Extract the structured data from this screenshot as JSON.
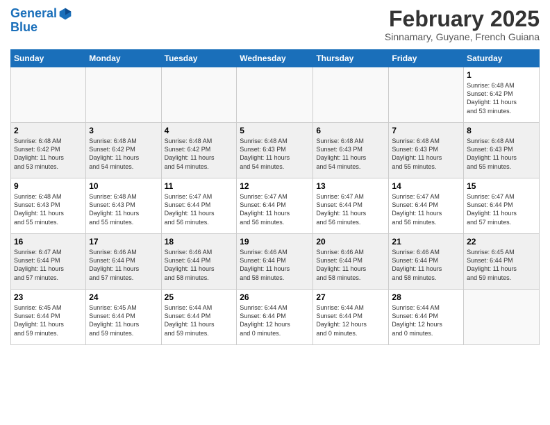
{
  "logo": {
    "line1": "General",
    "line2": "Blue"
  },
  "title": "February 2025",
  "subtitle": "Sinnamary, Guyane, French Guiana",
  "days_of_week": [
    "Sunday",
    "Monday",
    "Tuesday",
    "Wednesday",
    "Thursday",
    "Friday",
    "Saturday"
  ],
  "weeks": [
    {
      "shaded": false,
      "days": [
        {
          "num": "",
          "info": ""
        },
        {
          "num": "",
          "info": ""
        },
        {
          "num": "",
          "info": ""
        },
        {
          "num": "",
          "info": ""
        },
        {
          "num": "",
          "info": ""
        },
        {
          "num": "",
          "info": ""
        },
        {
          "num": "1",
          "info": "Sunrise: 6:48 AM\nSunset: 6:42 PM\nDaylight: 11 hours\nand 53 minutes."
        }
      ]
    },
    {
      "shaded": true,
      "days": [
        {
          "num": "2",
          "info": "Sunrise: 6:48 AM\nSunset: 6:42 PM\nDaylight: 11 hours\nand 53 minutes."
        },
        {
          "num": "3",
          "info": "Sunrise: 6:48 AM\nSunset: 6:42 PM\nDaylight: 11 hours\nand 54 minutes."
        },
        {
          "num": "4",
          "info": "Sunrise: 6:48 AM\nSunset: 6:42 PM\nDaylight: 11 hours\nand 54 minutes."
        },
        {
          "num": "5",
          "info": "Sunrise: 6:48 AM\nSunset: 6:43 PM\nDaylight: 11 hours\nand 54 minutes."
        },
        {
          "num": "6",
          "info": "Sunrise: 6:48 AM\nSunset: 6:43 PM\nDaylight: 11 hours\nand 54 minutes."
        },
        {
          "num": "7",
          "info": "Sunrise: 6:48 AM\nSunset: 6:43 PM\nDaylight: 11 hours\nand 55 minutes."
        },
        {
          "num": "8",
          "info": "Sunrise: 6:48 AM\nSunset: 6:43 PM\nDaylight: 11 hours\nand 55 minutes."
        }
      ]
    },
    {
      "shaded": false,
      "days": [
        {
          "num": "9",
          "info": "Sunrise: 6:48 AM\nSunset: 6:43 PM\nDaylight: 11 hours\nand 55 minutes."
        },
        {
          "num": "10",
          "info": "Sunrise: 6:48 AM\nSunset: 6:43 PM\nDaylight: 11 hours\nand 55 minutes."
        },
        {
          "num": "11",
          "info": "Sunrise: 6:47 AM\nSunset: 6:44 PM\nDaylight: 11 hours\nand 56 minutes."
        },
        {
          "num": "12",
          "info": "Sunrise: 6:47 AM\nSunset: 6:44 PM\nDaylight: 11 hours\nand 56 minutes."
        },
        {
          "num": "13",
          "info": "Sunrise: 6:47 AM\nSunset: 6:44 PM\nDaylight: 11 hours\nand 56 minutes."
        },
        {
          "num": "14",
          "info": "Sunrise: 6:47 AM\nSunset: 6:44 PM\nDaylight: 11 hours\nand 56 minutes."
        },
        {
          "num": "15",
          "info": "Sunrise: 6:47 AM\nSunset: 6:44 PM\nDaylight: 11 hours\nand 57 minutes."
        }
      ]
    },
    {
      "shaded": true,
      "days": [
        {
          "num": "16",
          "info": "Sunrise: 6:47 AM\nSunset: 6:44 PM\nDaylight: 11 hours\nand 57 minutes."
        },
        {
          "num": "17",
          "info": "Sunrise: 6:46 AM\nSunset: 6:44 PM\nDaylight: 11 hours\nand 57 minutes."
        },
        {
          "num": "18",
          "info": "Sunrise: 6:46 AM\nSunset: 6:44 PM\nDaylight: 11 hours\nand 58 minutes."
        },
        {
          "num": "19",
          "info": "Sunrise: 6:46 AM\nSunset: 6:44 PM\nDaylight: 11 hours\nand 58 minutes."
        },
        {
          "num": "20",
          "info": "Sunrise: 6:46 AM\nSunset: 6:44 PM\nDaylight: 11 hours\nand 58 minutes."
        },
        {
          "num": "21",
          "info": "Sunrise: 6:46 AM\nSunset: 6:44 PM\nDaylight: 11 hours\nand 58 minutes."
        },
        {
          "num": "22",
          "info": "Sunrise: 6:45 AM\nSunset: 6:44 PM\nDaylight: 11 hours\nand 59 minutes."
        }
      ]
    },
    {
      "shaded": false,
      "days": [
        {
          "num": "23",
          "info": "Sunrise: 6:45 AM\nSunset: 6:44 PM\nDaylight: 11 hours\nand 59 minutes."
        },
        {
          "num": "24",
          "info": "Sunrise: 6:45 AM\nSunset: 6:44 PM\nDaylight: 11 hours\nand 59 minutes."
        },
        {
          "num": "25",
          "info": "Sunrise: 6:44 AM\nSunset: 6:44 PM\nDaylight: 11 hours\nand 59 minutes."
        },
        {
          "num": "26",
          "info": "Sunrise: 6:44 AM\nSunset: 6:44 PM\nDaylight: 12 hours\nand 0 minutes."
        },
        {
          "num": "27",
          "info": "Sunrise: 6:44 AM\nSunset: 6:44 PM\nDaylight: 12 hours\nand 0 minutes."
        },
        {
          "num": "28",
          "info": "Sunrise: 6:44 AM\nSunset: 6:44 PM\nDaylight: 12 hours\nand 0 minutes."
        },
        {
          "num": "",
          "info": ""
        }
      ]
    }
  ]
}
